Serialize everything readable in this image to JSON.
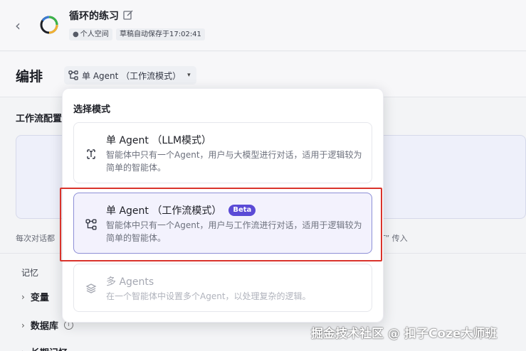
{
  "header": {
    "back_glyph": "‹",
    "title": "循环的练习",
    "tags": {
      "space": "个人空间",
      "autosave": "草稿自动保存于17:02:41"
    }
  },
  "toolbar": {
    "section_title": "编排",
    "mode_selected": "单 Agent （工作流模式）",
    "caret": "▾"
  },
  "background": {
    "workflow_config_label": "工作流配置",
    "note_left": "每次对话都",
    "note_right": "T” 传入",
    "memory_label": "记忆",
    "rows": [
      {
        "label": "变量",
        "chevron": "›"
      },
      {
        "label": "数据库",
        "chevron": "›",
        "info": "i"
      },
      {
        "label": "长期记忆",
        "chevron": "›"
      }
    ]
  },
  "dropdown": {
    "heading": "选择模式",
    "options": [
      {
        "title": "单 Agent （LLM模式）",
        "description": "智能体中只有一个Agent，用户与大模型进行对话，适用于逻辑较为简单的智能体。",
        "icon": "llm-mode-icon",
        "selected": false,
        "disabled": false
      },
      {
        "title": "单 Agent （工作流模式）",
        "badge": "Beta",
        "description": "智能体中只有一个Agent，用户与工作流进行对话，适用于逻辑较为简单的智能体。",
        "icon": "workflow-mode-icon",
        "selected": true,
        "disabled": false
      },
      {
        "title": "多 Agents",
        "description": "在一个智能体中设置多个Agent，以处理复杂的逻辑。",
        "icon": "multi-agents-icon",
        "selected": false,
        "disabled": true
      }
    ]
  },
  "watermark": "掘金技术社区 @ 扣子Coze大师班",
  "colors": {
    "accent": "#5b4bd6",
    "selected_bg": "#f3f2fd",
    "selected_border": "#8d8fd6",
    "highlight_red": "#d9332b"
  }
}
